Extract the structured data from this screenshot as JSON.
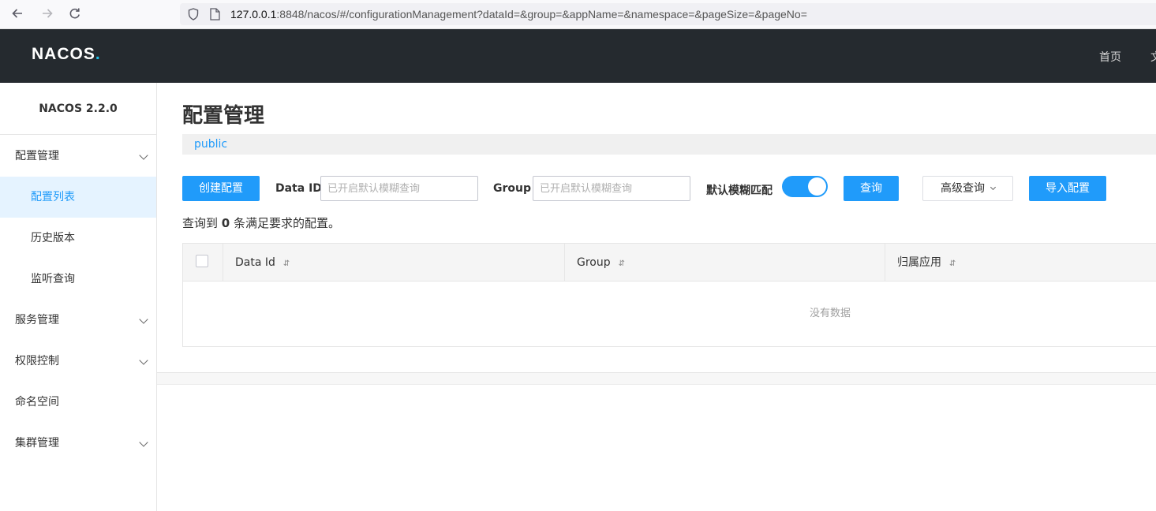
{
  "browser": {
    "url_host": "127.0.0.1",
    "url_rest": ":8848/nacos/#/configurationManagement?dataId=&group=&appName=&namespace=&pageSize=&pageNo="
  },
  "header": {
    "logo": "NACOS",
    "logo_dot": ".",
    "home_link": "首页",
    "partial_link": "文"
  },
  "sidebar": {
    "version": "NACOS 2.2.0",
    "items": [
      {
        "label": "配置管理",
        "expandable": true
      },
      {
        "label": "配置列表",
        "active": true
      },
      {
        "label": "历史版本"
      },
      {
        "label": "监听查询"
      },
      {
        "label": "服务管理",
        "expandable": true
      },
      {
        "label": "权限控制",
        "expandable": true
      },
      {
        "label": "命名空间"
      },
      {
        "label": "集群管理",
        "expandable": true
      }
    ]
  },
  "main": {
    "title": "配置管理",
    "namespace": "public",
    "create_button": "创建配置",
    "data_id_label": "Data ID",
    "data_id_placeholder": "已开启默认模糊查询",
    "group_label": "Group",
    "group_placeholder": "已开启默认模糊查询",
    "fuzzy_label": "默认模糊匹配",
    "fuzzy_enabled": true,
    "query_button": "查询",
    "advanced_button": "高级查询",
    "import_button": "导入配置",
    "result_prefix": "查询到",
    "result_count": "0",
    "result_suffix": "条满足要求的配置。"
  },
  "table": {
    "columns": [
      "Data Id",
      "Group",
      "归属应用"
    ],
    "sort_icon": "⇵",
    "empty_text": "没有数据"
  },
  "colors": {
    "accent": "#209bfa",
    "header_bg": "#252a2f",
    "active_bg": "#e5f3ff"
  }
}
